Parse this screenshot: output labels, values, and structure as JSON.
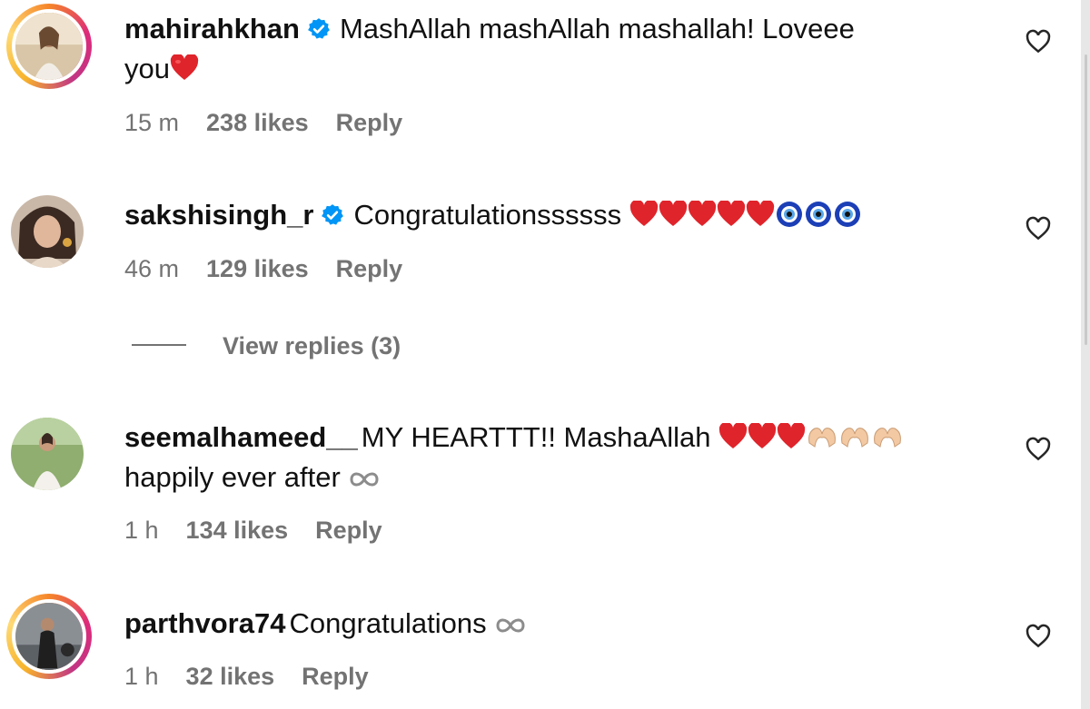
{
  "comments": [
    {
      "username": "mahirahkhan",
      "verified": true,
      "text": "MashAllah mashAllah mashallah! Loveee",
      "text_line2": "you",
      "trailing_emoji": [
        "red-heart"
      ],
      "time": "15 m",
      "likes": "238 likes",
      "reply": "Reply"
    },
    {
      "username": "sakshisingh_r",
      "verified": true,
      "text": "Congratulationssssss",
      "trailing_emoji": [
        "red-heart",
        "red-heart",
        "red-heart",
        "red-heart",
        "red-heart",
        "nazar-amulet",
        "nazar-amulet",
        "nazar-amulet"
      ],
      "time": "46 m",
      "likes": "129 likes",
      "reply": "Reply"
    },
    {
      "username": "seemalhameed__",
      "verified": false,
      "text": "MY HEARTTT!! MashaAllah",
      "trailing_emoji": [
        "red-heart",
        "red-heart",
        "red-heart",
        "heart-hands",
        "heart-hands",
        "heart-hands"
      ],
      "text_line2": "happily ever after",
      "line2_emoji": [
        "infinity"
      ],
      "time": "1 h",
      "likes": "134 likes",
      "reply": "Reply"
    },
    {
      "username": "parthvora74",
      "verified": false,
      "text": "Congratulations",
      "trailing_emoji": [
        "infinity"
      ],
      "time": "1 h",
      "likes": "32 likes",
      "reply": "Reply"
    }
  ],
  "view_replies": "View replies (3)",
  "colors": {
    "verified_blue": "#0095f6",
    "meta_gray": "#737373",
    "heart_red": "#e0242b"
  },
  "icons": [
    "verified-badge-icon",
    "heart-outline-icon",
    "red-heart-emoji",
    "nazar-amulet-emoji",
    "heart-hands-emoji",
    "infinity-emoji"
  ]
}
